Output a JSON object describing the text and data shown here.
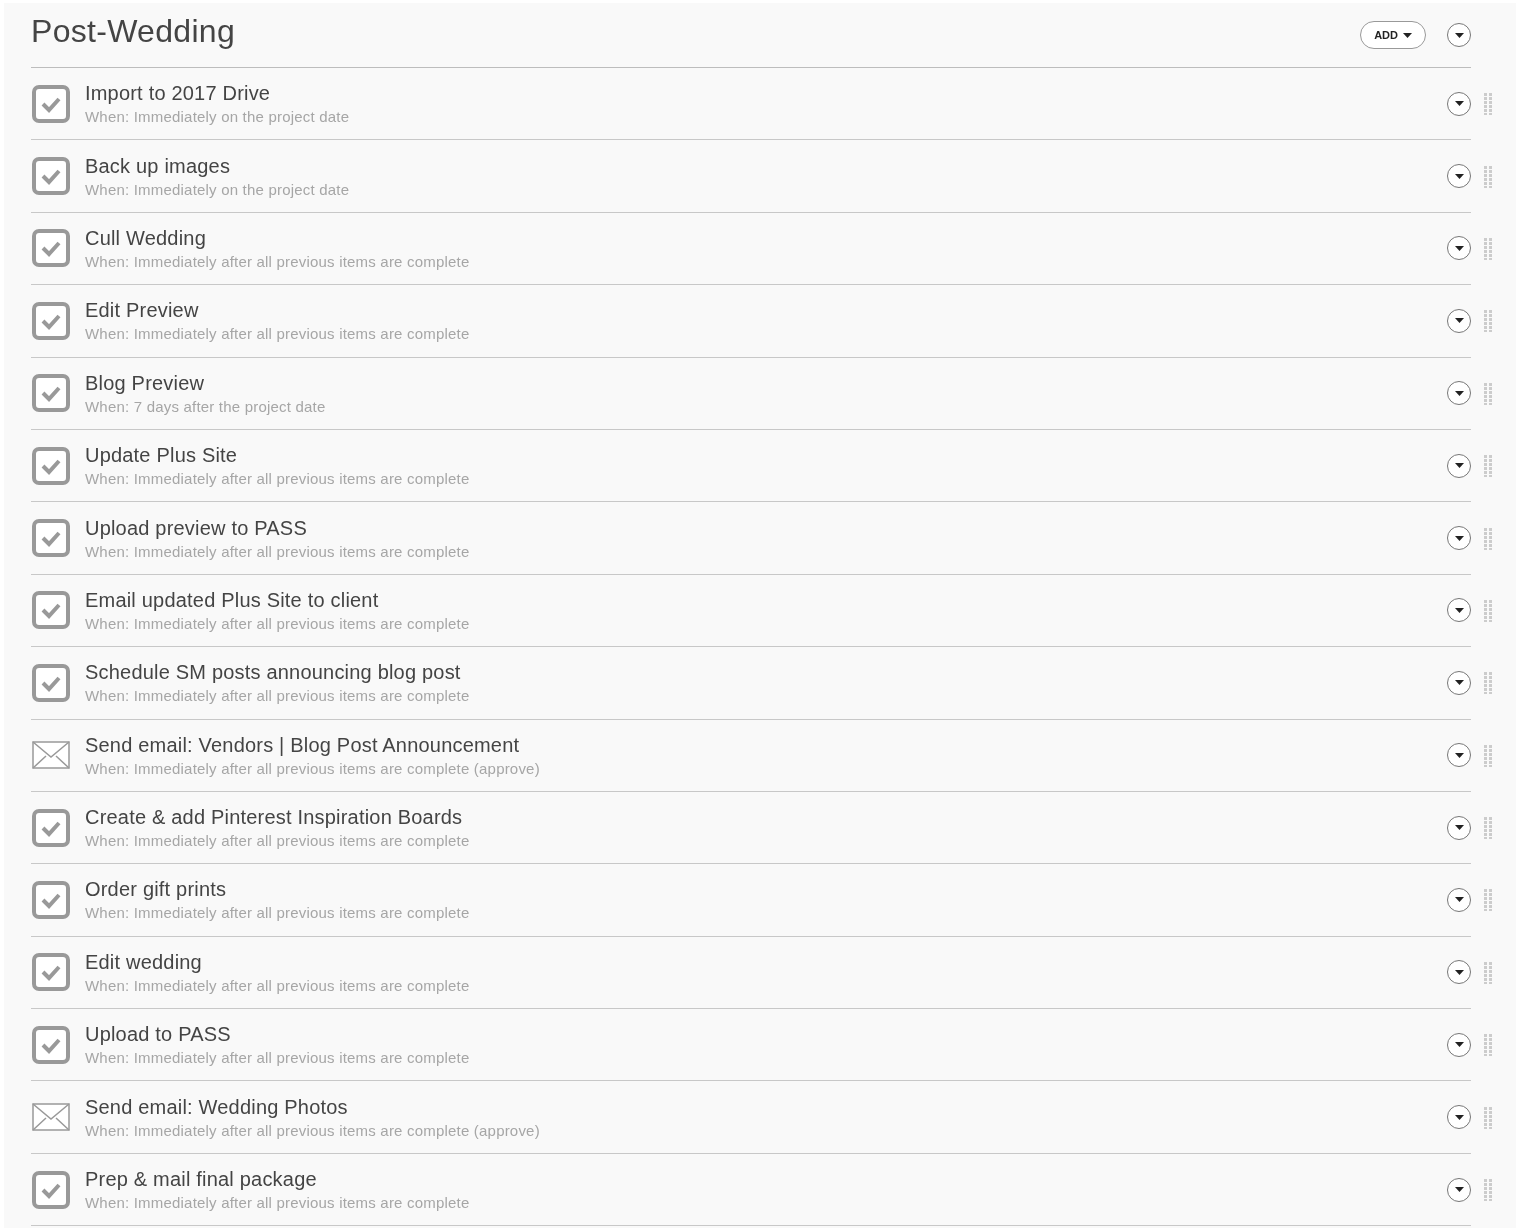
{
  "section": {
    "title": "Post-Wedding",
    "add_button": "ADD"
  },
  "items": [
    {
      "kind": "task",
      "title": "Import to 2017 Drive",
      "when": "When: Immediately on the project date"
    },
    {
      "kind": "task",
      "title": "Back up images",
      "when": "When: Immediately on the project date"
    },
    {
      "kind": "task",
      "title": "Cull Wedding",
      "when": "When: Immediately after all previous items are complete"
    },
    {
      "kind": "task",
      "title": "Edit Preview",
      "when": "When: Immediately after all previous items are complete"
    },
    {
      "kind": "task",
      "title": "Blog Preview",
      "when": "When: 7 days after the project date"
    },
    {
      "kind": "task",
      "title": "Update Plus Site",
      "when": "When: Immediately after all previous items are complete"
    },
    {
      "kind": "task",
      "title": "Upload preview to PASS",
      "when": "When: Immediately after all previous items are complete"
    },
    {
      "kind": "task",
      "title": "Email updated Plus Site to client",
      "when": "When: Immediately after all previous items are complete"
    },
    {
      "kind": "task",
      "title": "Schedule SM posts announcing blog post",
      "when": "When: Immediately after all previous items are complete"
    },
    {
      "kind": "email",
      "title": "Send email: Vendors | Blog Post Announcement",
      "when": "When: Immediately after all previous items are complete (approve)"
    },
    {
      "kind": "task",
      "title": "Create & add Pinterest Inspiration Boards",
      "when": "When: Immediately after all previous items are complete"
    },
    {
      "kind": "task",
      "title": "Order gift prints",
      "when": "When: Immediately after all previous items are complete"
    },
    {
      "kind": "task",
      "title": "Edit wedding",
      "when": "When: Immediately after all previous items are complete"
    },
    {
      "kind": "task",
      "title": "Upload to PASS",
      "when": "When: Immediately after all previous items are complete"
    },
    {
      "kind": "email",
      "title": "Send email: Wedding Photos",
      "when": "When: Immediately after all previous items are complete (approve)"
    },
    {
      "kind": "task",
      "title": "Prep & mail final package",
      "when": "When: Immediately after all previous items are complete"
    }
  ]
}
